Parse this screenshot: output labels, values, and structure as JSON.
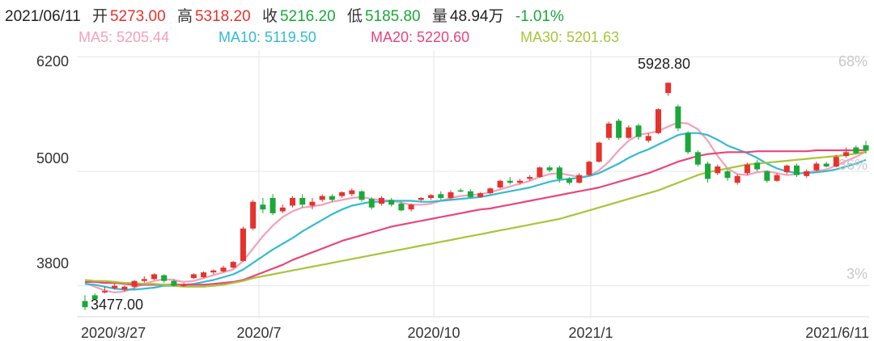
{
  "header": {
    "date": "2021/06/11",
    "open_label": "开",
    "open": "5273.00",
    "high_label": "高",
    "high": "5318.20",
    "close_label": "收",
    "close": "5216.20",
    "low_label": "低",
    "low": "5185.80",
    "volume_label": "量",
    "volume": "48.94万",
    "change": "-1.01%"
  },
  "moving_averages": [
    {
      "label": "MA5: 5205.44",
      "color": "#f4a0b8"
    },
    {
      "label": "MA10: 5119.50",
      "color": "#33bbd0"
    },
    {
      "label": "MA20: 5220.60",
      "color": "#e8467a"
    },
    {
      "label": "MA30: 5201.63",
      "color": "#a8c43a"
    }
  ],
  "colors": {
    "up": "#e5322d",
    "down": "#1aa83a",
    "grid": "#e6e6e6"
  },
  "chart_data": {
    "type": "candlestick",
    "y_ticks": [
      "6200",
      "5000",
      "3800"
    ],
    "y_right_ticks": [
      "68%",
      "36%",
      "3%"
    ],
    "x_ticks": [
      "2020/3/27",
      "2020/7",
      "2020/10",
      "2021/1",
      "2021/6/11"
    ],
    "annotations": {
      "high": "5928.80",
      "low": "3477.00"
    },
    "ylim": [
      3475,
      6270
    ],
    "candles": [
      [
        3640,
        3575,
        3700,
        3545
      ],
      [
        3700,
        3660,
        3720,
        3650
      ],
      [
        3730,
        3745,
        3790,
        3720
      ],
      [
        3775,
        3800,
        3830,
        3760
      ],
      [
        3760,
        3790,
        3800,
        3740
      ],
      [
        3790,
        3850,
        3860,
        3770
      ],
      [
        3850,
        3870,
        3900,
        3830
      ],
      [
        3870,
        3920,
        3930,
        3860
      ],
      [
        3910,
        3850,
        3920,
        3830
      ],
      [
        3850,
        3800,
        3870,
        3790
      ],
      [
        3800,
        3810,
        3830,
        3790
      ],
      [
        3880,
        3920,
        3930,
        3870
      ],
      [
        3890,
        3940,
        3950,
        3880
      ],
      [
        3940,
        3960,
        3970,
        3920
      ],
      [
        3950,
        3990,
        4010,
        3940
      ],
      [
        3990,
        4050,
        4060,
        3980
      ],
      [
        4060,
        4400,
        4420,
        4050
      ],
      [
        4400,
        4680,
        4700,
        4380
      ],
      [
        4650,
        4600,
        4720,
        4560
      ],
      [
        4720,
        4560,
        4760,
        4540
      ],
      [
        4580,
        4620,
        4650,
        4560
      ],
      [
        4640,
        4720,
        4740,
        4620
      ],
      [
        4720,
        4650,
        4760,
        4620
      ],
      [
        4640,
        4680,
        4720,
        4600
      ],
      [
        4700,
        4740,
        4760,
        4680
      ],
      [
        4740,
        4700,
        4760,
        4680
      ],
      [
        4740,
        4780,
        4790,
        4720
      ],
      [
        4760,
        4800,
        4820,
        4740
      ],
      [
        4790,
        4700,
        4800,
        4680
      ],
      [
        4710,
        4620,
        4730,
        4600
      ],
      [
        4660,
        4720,
        4740,
        4640
      ],
      [
        4700,
        4650,
        4720,
        4630
      ],
      [
        4660,
        4590,
        4680,
        4580
      ],
      [
        4600,
        4650,
        4660,
        4580
      ],
      [
        4700,
        4720,
        4730,
        4690
      ],
      [
        4720,
        4750,
        4760,
        4700
      ],
      [
        4760,
        4720,
        4790,
        4700
      ],
      [
        4720,
        4780,
        4800,
        4700
      ],
      [
        4800,
        4790,
        4820,
        4780
      ],
      [
        4790,
        4730,
        4810,
        4720
      ],
      [
        4730,
        4770,
        4780,
        4720
      ],
      [
        4770,
        4820,
        4830,
        4760
      ],
      [
        4830,
        4900,
        4910,
        4820
      ],
      [
        4900,
        4880,
        4940,
        4860
      ],
      [
        4880,
        4900,
        4920,
        4860
      ],
      [
        4920,
        4940,
        4960,
        4900
      ],
      [
        4940,
        5040,
        5050,
        4930
      ],
      [
        5040,
        5010,
        5060,
        4990
      ],
      [
        5040,
        4920,
        5060,
        4880
      ],
      [
        4920,
        4880,
        4940,
        4860
      ],
      [
        4880,
        4960,
        4980,
        4870
      ],
      [
        4960,
        5100,
        5110,
        4950
      ],
      [
        5100,
        5300,
        5310,
        5090
      ],
      [
        5350,
        5500,
        5520,
        5330
      ],
      [
        5530,
        5350,
        5550,
        5330
      ],
      [
        5350,
        5460,
        5480,
        5340
      ],
      [
        5480,
        5360,
        5500,
        5330
      ],
      [
        5320,
        5370,
        5400,
        5300
      ],
      [
        5400,
        5650,
        5660,
        5390
      ],
      [
        5820,
        5928,
        5928,
        5790
      ],
      [
        5680,
        5450,
        5700,
        5420
      ],
      [
        5400,
        5200,
        5420,
        5180
      ],
      [
        5200,
        5070,
        5220,
        5050
      ],
      [
        5080,
        4920,
        5100,
        4880
      ],
      [
        4980,
        5050,
        5070,
        4960
      ],
      [
        5000,
        4930,
        5020,
        4900
      ],
      [
        4880,
        4950,
        4970,
        4860
      ],
      [
        4980,
        5070,
        5090,
        4960
      ],
      [
        5090,
        5020,
        5120,
        5000
      ],
      [
        5000,
        4900,
        5010,
        4880
      ],
      [
        4900,
        4960,
        4980,
        4890
      ],
      [
        4990,
        5060,
        5070,
        4970
      ],
      [
        5060,
        4960,
        5080,
        4940
      ],
      [
        4950,
        5000,
        5020,
        4930
      ],
      [
        5010,
        5080,
        5100,
        5000
      ],
      [
        5080,
        5050,
        5100,
        5040
      ],
      [
        5050,
        5150,
        5170,
        5040
      ],
      [
        5160,
        5200,
        5250,
        5140
      ],
      [
        5250,
        5190,
        5270,
        5180
      ],
      [
        5273,
        5216,
        5318,
        5186
      ]
    ],
    "series": [
      {
        "name": "MA5",
        "color": "#f4a0b8",
        "values": [
          3830,
          3790,
          3750,
          3730,
          3740,
          3780,
          3820,
          3850,
          3870,
          3860,
          3840,
          3850,
          3880,
          3910,
          3940,
          3970,
          4060,
          4190,
          4320,
          4430,
          4520,
          4580,
          4620,
          4630,
          4650,
          4680,
          4700,
          4720,
          4730,
          4710,
          4700,
          4690,
          4670,
          4650,
          4650,
          4660,
          4690,
          4720,
          4740,
          4750,
          4760,
          4780,
          4810,
          4840,
          4870,
          4900,
          4940,
          4970,
          4980,
          4960,
          4940,
          4950,
          5010,
          5100,
          5220,
          5320,
          5380,
          5400,
          5420,
          5470,
          5510,
          5500,
          5440,
          5320,
          5160,
          5030,
          4970,
          4960,
          4990,
          5000,
          4980,
          4960,
          4970,
          4990,
          5000,
          5020,
          5060,
          5110,
          5150,
          5205
        ]
      },
      {
        "name": "MA10",
        "color": "#33bbd0",
        "values": [
          3820,
          3810,
          3790,
          3770,
          3760,
          3760,
          3770,
          3780,
          3800,
          3800,
          3810,
          3820,
          3840,
          3860,
          3890,
          3920,
          3970,
          4040,
          4110,
          4180,
          4240,
          4300,
          4370,
          4430,
          4490,
          4550,
          4600,
          4640,
          4660,
          4680,
          4680,
          4690,
          4690,
          4690,
          4680,
          4680,
          4690,
          4700,
          4710,
          4720,
          4730,
          4750,
          4770,
          4790,
          4810,
          4830,
          4860,
          4890,
          4910,
          4920,
          4930,
          4950,
          4980,
          5030,
          5080,
          5140,
          5190,
          5230,
          5280,
          5330,
          5380,
          5400,
          5400,
          5380,
          5330,
          5270,
          5230,
          5190,
          5140,
          5080,
          5030,
          5000,
          4980,
          4980,
          4990,
          5000,
          5020,
          5050,
          5080,
          5120
        ]
      },
      {
        "name": "MA20",
        "color": "#e8467a",
        "values": [
          3840,
          3840,
          3830,
          3830,
          3820,
          3810,
          3810,
          3810,
          3810,
          3810,
          3810,
          3810,
          3810,
          3820,
          3830,
          3840,
          3860,
          3900,
          3940,
          3980,
          4020,
          4070,
          4110,
          4150,
          4190,
          4230,
          4270,
          4300,
          4330,
          4360,
          4390,
          4420,
          4440,
          4460,
          4480,
          4500,
          4520,
          4540,
          4560,
          4580,
          4600,
          4610,
          4630,
          4650,
          4670,
          4690,
          4710,
          4730,
          4750,
          4770,
          4790,
          4810,
          4830,
          4860,
          4890,
          4920,
          4950,
          4980,
          5020,
          5060,
          5100,
          5130,
          5160,
          5180,
          5190,
          5200,
          5200,
          5200,
          5210,
          5210,
          5210,
          5210,
          5210,
          5210,
          5220,
          5220,
          5220,
          5220,
          5220,
          5221
        ]
      },
      {
        "name": "MA30",
        "color": "#a8c43a",
        "values": [
          3860,
          3850,
          3850,
          3840,
          3830,
          3830,
          3820,
          3820,
          3810,
          3800,
          3790,
          3790,
          3790,
          3800,
          3810,
          3830,
          3850,
          3880,
          3900,
          3920,
          3940,
          3960,
          3980,
          4000,
          4020,
          4040,
          4060,
          4080,
          4100,
          4120,
          4140,
          4160,
          4180,
          4200,
          4220,
          4240,
          4260,
          4280,
          4300,
          4320,
          4340,
          4360,
          4380,
          4400,
          4420,
          4440,
          4460,
          4480,
          4500,
          4530,
          4560,
          4590,
          4620,
          4650,
          4680,
          4710,
          4740,
          4770,
          4800,
          4840,
          4880,
          4920,
          4960,
          4990,
          5010,
          5030,
          5050,
          5070,
          5080,
          5090,
          5100,
          5110,
          5120,
          5130,
          5140,
          5150,
          5160,
          5170,
          5185,
          5202
        ]
      }
    ]
  }
}
